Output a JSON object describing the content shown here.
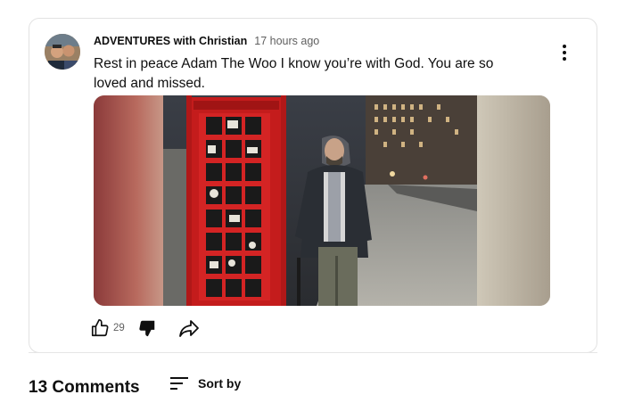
{
  "post": {
    "author": "ADVENTURES with Christian",
    "timestamp": "17 hours ago",
    "text": "Rest in peace Adam The Woo I know you’re with God. You are so loved and missed.",
    "image_alt": "",
    "like_count": "29"
  },
  "comments": {
    "title": "13 Comments",
    "sort_label": "Sort by"
  },
  "icons": {
    "menu": "vertical-dots-icon",
    "like": "thumbs-up-icon",
    "dislike": "thumbs-down-icon",
    "share": "share-arrow-icon",
    "sort": "sort-lines-icon"
  },
  "colors": {
    "text_primary": "#0f0f0f",
    "text_secondary": "#606060",
    "phone_box_red": "#d11f1f"
  }
}
